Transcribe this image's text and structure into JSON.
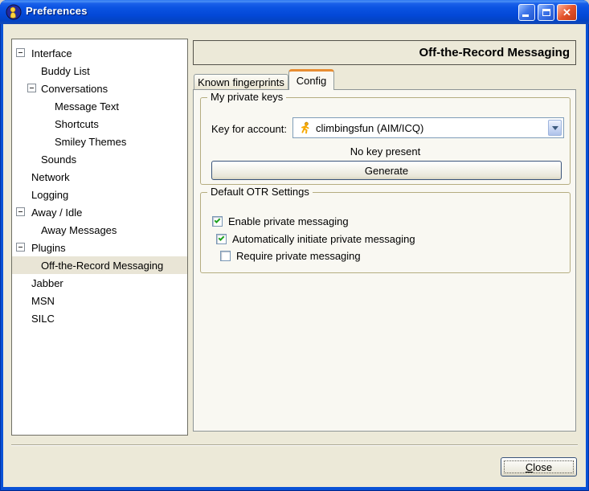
{
  "window": {
    "title": "Preferences"
  },
  "icons": {
    "app": "gaim-buddy-person",
    "minimize": "_",
    "maximize": "□",
    "close": "✕",
    "tree_expander_open": "−",
    "aim_account": "aim-running-man",
    "dropdown": "▾",
    "checkmark": "✓"
  },
  "sidebar": {
    "items": [
      {
        "label": "Interface",
        "level": 0,
        "expander": true,
        "selected": false
      },
      {
        "label": "Buddy List",
        "level": 1,
        "expander": false,
        "selected": false
      },
      {
        "label": "Conversations",
        "level": 1,
        "expander": true,
        "selected": false
      },
      {
        "label": "Message Text",
        "level": 2,
        "expander": false,
        "selected": false
      },
      {
        "label": "Shortcuts",
        "level": 2,
        "expander": false,
        "selected": false
      },
      {
        "label": "Smiley Themes",
        "level": 2,
        "expander": false,
        "selected": false
      },
      {
        "label": "Sounds",
        "level": 1,
        "expander": false,
        "selected": false
      },
      {
        "label": "Network",
        "level": 0,
        "expander": false,
        "selected": false
      },
      {
        "label": "Logging",
        "level": 0,
        "expander": false,
        "selected": false
      },
      {
        "label": "Away / Idle",
        "level": 0,
        "expander": true,
        "selected": false
      },
      {
        "label": "Away Messages",
        "level": 1,
        "expander": false,
        "selected": false
      },
      {
        "label": "Plugins",
        "level": 0,
        "expander": true,
        "selected": false
      },
      {
        "label": "Off-the-Record Messaging",
        "level": 1,
        "expander": false,
        "selected": true
      },
      {
        "label": "Jabber",
        "level": 0,
        "expander": false,
        "selected": false
      },
      {
        "label": "MSN",
        "level": 0,
        "expander": false,
        "selected": false
      },
      {
        "label": "SILC",
        "level": 0,
        "expander": false,
        "selected": false
      }
    ]
  },
  "panel": {
    "header": "Off-the-Record Messaging",
    "tabs": [
      {
        "label": "Known fingerprints",
        "active": false
      },
      {
        "label": "Config",
        "active": true
      }
    ],
    "private_keys": {
      "group_label": "My private keys",
      "account_label": "Key for account:",
      "account_value": "climbingsfun (AIM/ICQ)",
      "status": "No key present",
      "generate_label": "Generate"
    },
    "otr_settings": {
      "group_label": "Default OTR Settings",
      "checkboxes": [
        {
          "label": "Enable private messaging",
          "checked": true
        },
        {
          "label": "Automatically initiate private messaging",
          "checked": true
        },
        {
          "label": "Require private messaging",
          "checked": false
        }
      ]
    }
  },
  "footer": {
    "close_label": "Close"
  },
  "colors": {
    "titlebar_blue": "#0a53dd",
    "window_bg": "#ece9d8",
    "panel_bg": "#f9f8f2",
    "active_tab_orange": "#e78d33",
    "selection_bg": "#e9e5d6",
    "check_green": "#1ea11e",
    "close_button_red": "#d6552e",
    "combo_border": "#7f9db9",
    "groupbox_border": "#b5ad80"
  }
}
